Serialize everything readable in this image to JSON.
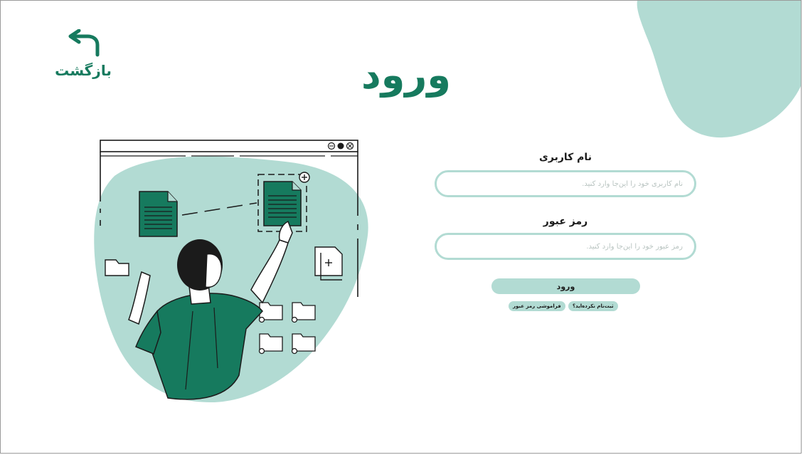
{
  "page": {
    "title": "ورود",
    "back_label": "بازگشت"
  },
  "form": {
    "username": {
      "label": "نام کاربری",
      "placeholder": "نام کاربری خود را این‌جا وارد کنید."
    },
    "password": {
      "label": "رمز عبور",
      "placeholder": "رمز عبور خود را این‌جا وارد کنید."
    },
    "submit_label": "ورود",
    "register_link": "ثبت‌نام نکرده‌اید؟",
    "forgot_link": "فراموشی رمز عبور"
  },
  "colors": {
    "brand": "#167a5e",
    "accent_light": "#b2dbd3",
    "ink": "#1b1b1b"
  },
  "icons": {
    "back": "back-arrow-icon"
  }
}
